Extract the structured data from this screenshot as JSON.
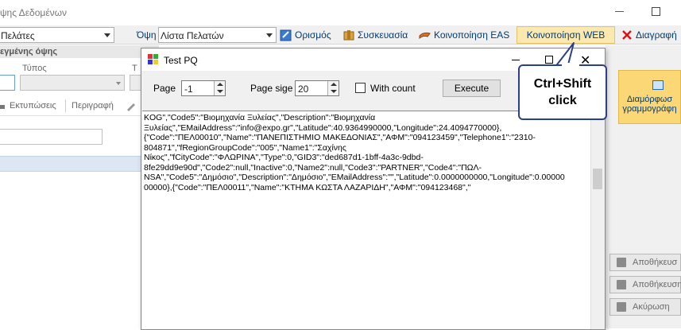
{
  "window": {
    "title": "ψης Δεδομένων"
  },
  "toolbar": {
    "entity_value": "Πελάτες",
    "view_label": "Όψη",
    "view_value": "Λίστα Πελατών",
    "define_label": "Ορισμός",
    "package_label": "Συσκευασία",
    "eas_label": "Κοινοποίηση EAS",
    "web_label": "Κοινοποίηση WEB",
    "delete_label": "Διαγραφή"
  },
  "left": {
    "section_title": "εγμένης όψης",
    "type_label": "Τύπος",
    "type_label2": "Τ",
    "tab_prints": "Εκτυπώσεις",
    "tab_description": "Περιγραφή"
  },
  "dialog": {
    "title": "Test PQ",
    "page_label": "Page",
    "page_value": "-1",
    "page_size_label": "Page sige",
    "page_size_value": "20",
    "with_count_label": "With count",
    "execute_label": "Execute",
    "output_text": "KOG\",\"Code5\":\"Βιομηχανία Ξυλείας\",\"Description\":\"Βιομηχανία\nΞυλείας\",\"EMailAddress\":\"info@expo.gr\",\"Latitude\":40.9364990000,\"Longitude\":24.4094770000},\n{\"Code\":\"ΠΕΛ00010\",\"Name\":\"ΠΑΝΕΠΙΣΤΗΜΙΟ ΜΑΚΕΔΟΝΙΑΣ\",\"ΑΦΜ\":\"094123459\",\"Telephone1\":\"2310-\n804871\",\"fRegionGroupCode\":\"005\",\"Name1\":\"Σαχίνης\nΝίκος\",\"fCityCode\":\"ΦΛΩΡΙΝΑ\",\"Type\":0,\"GID3\":\"ded687d1-1bff-4a3c-9dbd-\n8fe29dd9e90d\",\"Code2\":null,\"Inactive\":0,\"Name2\":null,\"Code3\":\"PARTNER\",\"Code4\":\"ΠΩΛ-\nNSA\",\"Code5\":\"Δημόσιο\",\"Description\":\"Δημόσιο\",\"EMailAddress\":\"\",\"Latitude\":0.0000000000,\"Longitude\":0.00000\n00000},{\"Code\":\"ΠΕΛ00011\",\"Name\":\"ΚΤΗΜΑ ΚΩΣΤΑ ΛΑΖΑΡΙΔΗ\",\"ΑΦΜ\":\"094123468\",\""
  },
  "right": {
    "format_line1": "Διαμόρφωσ",
    "format_line2": "γραμμογράφη",
    "save_label": "Αποθήκευσ",
    "save_as_label": "Αποθήκευση",
    "cancel_label": "Ακύρωση"
  },
  "callout": {
    "line1": "Ctrl+Shift",
    "line2": "click"
  },
  "colors": {
    "callout_border": "#2b3f8c",
    "highlight": "#fbe9b0",
    "link": "#003b73"
  }
}
